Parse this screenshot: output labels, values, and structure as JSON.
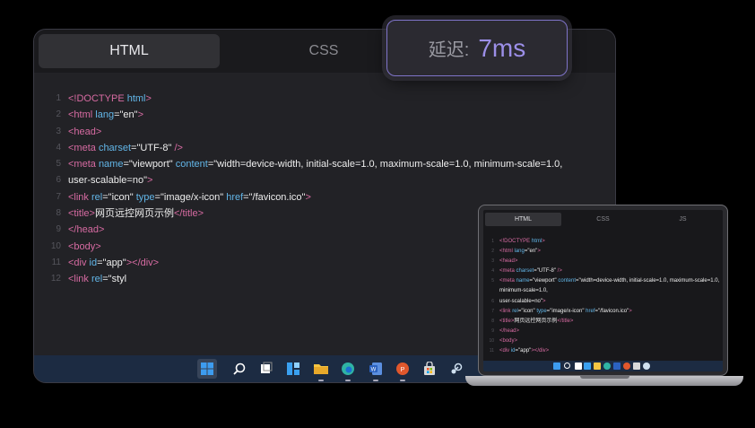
{
  "editor": {
    "tabs": [
      {
        "label": "HTML",
        "active": true
      },
      {
        "label": "CSS",
        "active": false
      }
    ],
    "code_lines": [
      {
        "num": "1",
        "parts": [
          [
            "tag",
            "<!DOCTYPE"
          ],
          [
            "txt",
            "  "
          ],
          [
            "attr",
            "html"
          ],
          [
            "tag",
            ">"
          ]
        ]
      },
      {
        "num": "2",
        "parts": [
          [
            "tag",
            "<html"
          ],
          [
            "txt",
            "  "
          ],
          [
            "attr",
            "lang"
          ],
          [
            "txt",
            "="
          ],
          [
            "str",
            "\"en\""
          ],
          [
            "tag",
            ">"
          ]
        ]
      },
      {
        "num": "3",
        "parts": [
          [
            "tag",
            "<head>"
          ]
        ]
      },
      {
        "num": "4",
        "parts": [
          [
            "tag",
            "<meta "
          ],
          [
            "attr",
            "charset"
          ],
          [
            "txt",
            "="
          ],
          [
            "str",
            "\"UTF-8\""
          ],
          [
            "tag",
            " />"
          ]
        ]
      },
      {
        "num": "5",
        "parts": [
          [
            "tag",
            "<meta "
          ],
          [
            "attr",
            "name"
          ],
          [
            "txt",
            "="
          ],
          [
            "str",
            "\"viewport\""
          ],
          [
            "txt",
            " "
          ],
          [
            "attr",
            "content"
          ],
          [
            "txt",
            "="
          ],
          [
            "str",
            "\"width=device-width, initial-scale=1.0, maximum-scale=1.0, minimum-scale=1.0,"
          ]
        ]
      },
      {
        "num": "6",
        "parts": [
          [
            "str",
            "user-scalable=no\""
          ],
          [
            "tag",
            ">"
          ]
        ]
      },
      {
        "num": "7",
        "parts": [
          [
            "tag",
            "<link "
          ],
          [
            "attr",
            "rel"
          ],
          [
            "txt",
            "="
          ],
          [
            "str",
            "\"icon\""
          ],
          [
            "txt",
            " "
          ],
          [
            "attr",
            "type"
          ],
          [
            "txt",
            "="
          ],
          [
            "str",
            "\"image/x-icon\""
          ],
          [
            "txt",
            " "
          ],
          [
            "attr",
            "href"
          ],
          [
            "txt",
            "="
          ],
          [
            "str",
            "\"/favicon.ico\""
          ],
          [
            "tag",
            ">"
          ]
        ]
      },
      {
        "num": "8",
        "parts": [
          [
            "tag",
            "<title>"
          ],
          [
            "txt",
            "网页远控网页示例"
          ],
          [
            "tag",
            "</title>"
          ]
        ]
      },
      {
        "num": "9",
        "parts": [
          [
            "tag",
            "</head>"
          ]
        ]
      },
      {
        "num": "10",
        "parts": [
          [
            "txt",
            " "
          ],
          [
            "tag",
            "<body>"
          ]
        ]
      },
      {
        "num": "11",
        "parts": [
          [
            "txt",
            " "
          ],
          [
            "tag",
            "<div "
          ],
          [
            "attr",
            "id"
          ],
          [
            "txt",
            "="
          ],
          [
            "str",
            "\"app\""
          ],
          [
            "tag",
            "></div>"
          ]
        ]
      },
      {
        "num": "12",
        "parts": [
          [
            "txt",
            " "
          ],
          [
            "tag",
            "<link "
          ],
          [
            "attr",
            "rel"
          ],
          [
            "txt",
            "="
          ],
          [
            "str",
            "\"styl"
          ]
        ]
      }
    ]
  },
  "latency": {
    "label": "延迟:",
    "value": "7ms",
    "accent": "#9c8fe8"
  },
  "laptop": {
    "tabs": [
      {
        "label": "HTML",
        "active": true
      },
      {
        "label": "CSS",
        "active": false
      },
      {
        "label": "JS",
        "active": false
      }
    ],
    "code_lines": [
      {
        "num": "1",
        "parts": [
          [
            "tag",
            "<!DOCTYPE"
          ],
          [
            "txt",
            "  "
          ],
          [
            "attr",
            "html"
          ],
          [
            "tag",
            ">"
          ]
        ]
      },
      {
        "num": "2",
        "parts": [
          [
            "tag",
            "<html"
          ],
          [
            "txt",
            "  "
          ],
          [
            "attr",
            "lang"
          ],
          [
            "txt",
            "="
          ],
          [
            "str",
            "\"en\""
          ],
          [
            "tag",
            ">"
          ]
        ]
      },
      {
        "num": "3",
        "parts": [
          [
            "tag",
            "<head>"
          ]
        ]
      },
      {
        "num": "4",
        "parts": [
          [
            "tag",
            "<meta "
          ],
          [
            "attr",
            "charset"
          ],
          [
            "txt",
            "="
          ],
          [
            "str",
            "\"UTF-8\""
          ],
          [
            "tag",
            " />"
          ]
        ]
      },
      {
        "num": "5",
        "parts": [
          [
            "tag",
            "<meta "
          ],
          [
            "attr",
            "name"
          ],
          [
            "txt",
            "="
          ],
          [
            "str",
            "\"viewport\""
          ],
          [
            "txt",
            " "
          ],
          [
            "attr",
            "content"
          ],
          [
            "txt",
            "="
          ],
          [
            "str",
            "\"width=device-width, initial-scale=1.0, maximum-scale=1.0,"
          ]
        ]
      },
      {
        "num": "",
        "parts": [
          [
            "str",
            "minimum-scale=1.0,"
          ]
        ]
      },
      {
        "num": "6",
        "parts": [
          [
            "str",
            "user-scalable=no\""
          ],
          [
            "tag",
            ">"
          ]
        ]
      },
      {
        "num": "7",
        "parts": [
          [
            "tag",
            "<link "
          ],
          [
            "attr",
            "rel"
          ],
          [
            "txt",
            "="
          ],
          [
            "str",
            "\"icon\""
          ],
          [
            "txt",
            " "
          ],
          [
            "attr",
            "type"
          ],
          [
            "txt",
            "="
          ],
          [
            "str",
            "\"image/x-icon\""
          ],
          [
            "txt",
            " "
          ],
          [
            "attr",
            "href"
          ],
          [
            "txt",
            "="
          ],
          [
            "str",
            "\"/favicon.ico\""
          ],
          [
            "tag",
            ">"
          ]
        ]
      },
      {
        "num": "8",
        "parts": [
          [
            "tag",
            "<title>"
          ],
          [
            "txt",
            "网页远控网页示例"
          ],
          [
            "tag",
            "</title>"
          ]
        ]
      },
      {
        "num": "9",
        "parts": [
          [
            "tag",
            "</head>"
          ]
        ]
      },
      {
        "num": "10",
        "parts": [
          [
            "txt",
            " "
          ],
          [
            "tag",
            "<body>"
          ]
        ]
      },
      {
        "num": "11",
        "parts": [
          [
            "txt",
            " "
          ],
          [
            "tag",
            "<div "
          ],
          [
            "attr",
            "id"
          ],
          [
            "txt",
            "="
          ],
          [
            "str",
            "\"app\""
          ],
          [
            "tag",
            "></div>"
          ]
        ]
      }
    ]
  },
  "taskbar": {
    "icons": [
      {
        "name": "windows-start-icon",
        "color": "#3d9cf0",
        "active": true
      },
      {
        "name": "search-icon",
        "color": "#ffffff",
        "active": false
      },
      {
        "name": "task-view-icon",
        "color": "#ffffff",
        "active": false
      },
      {
        "name": "widgets-icon",
        "color": "#3aa0f0",
        "active": false
      },
      {
        "name": "file-explorer-icon",
        "color": "#f5c542",
        "active": false
      },
      {
        "name": "edge-browser-icon",
        "color": "#2fb3a4",
        "active": false
      },
      {
        "name": "word-icon",
        "color": "#2b62c0",
        "active": false
      },
      {
        "name": "powerpoint-icon",
        "color": "#e0572c",
        "active": false
      },
      {
        "name": "store-icon",
        "color": "#d8d8d8",
        "active": false
      },
      {
        "name": "steam-icon",
        "color": "#cfe0f0",
        "active": false
      }
    ]
  }
}
